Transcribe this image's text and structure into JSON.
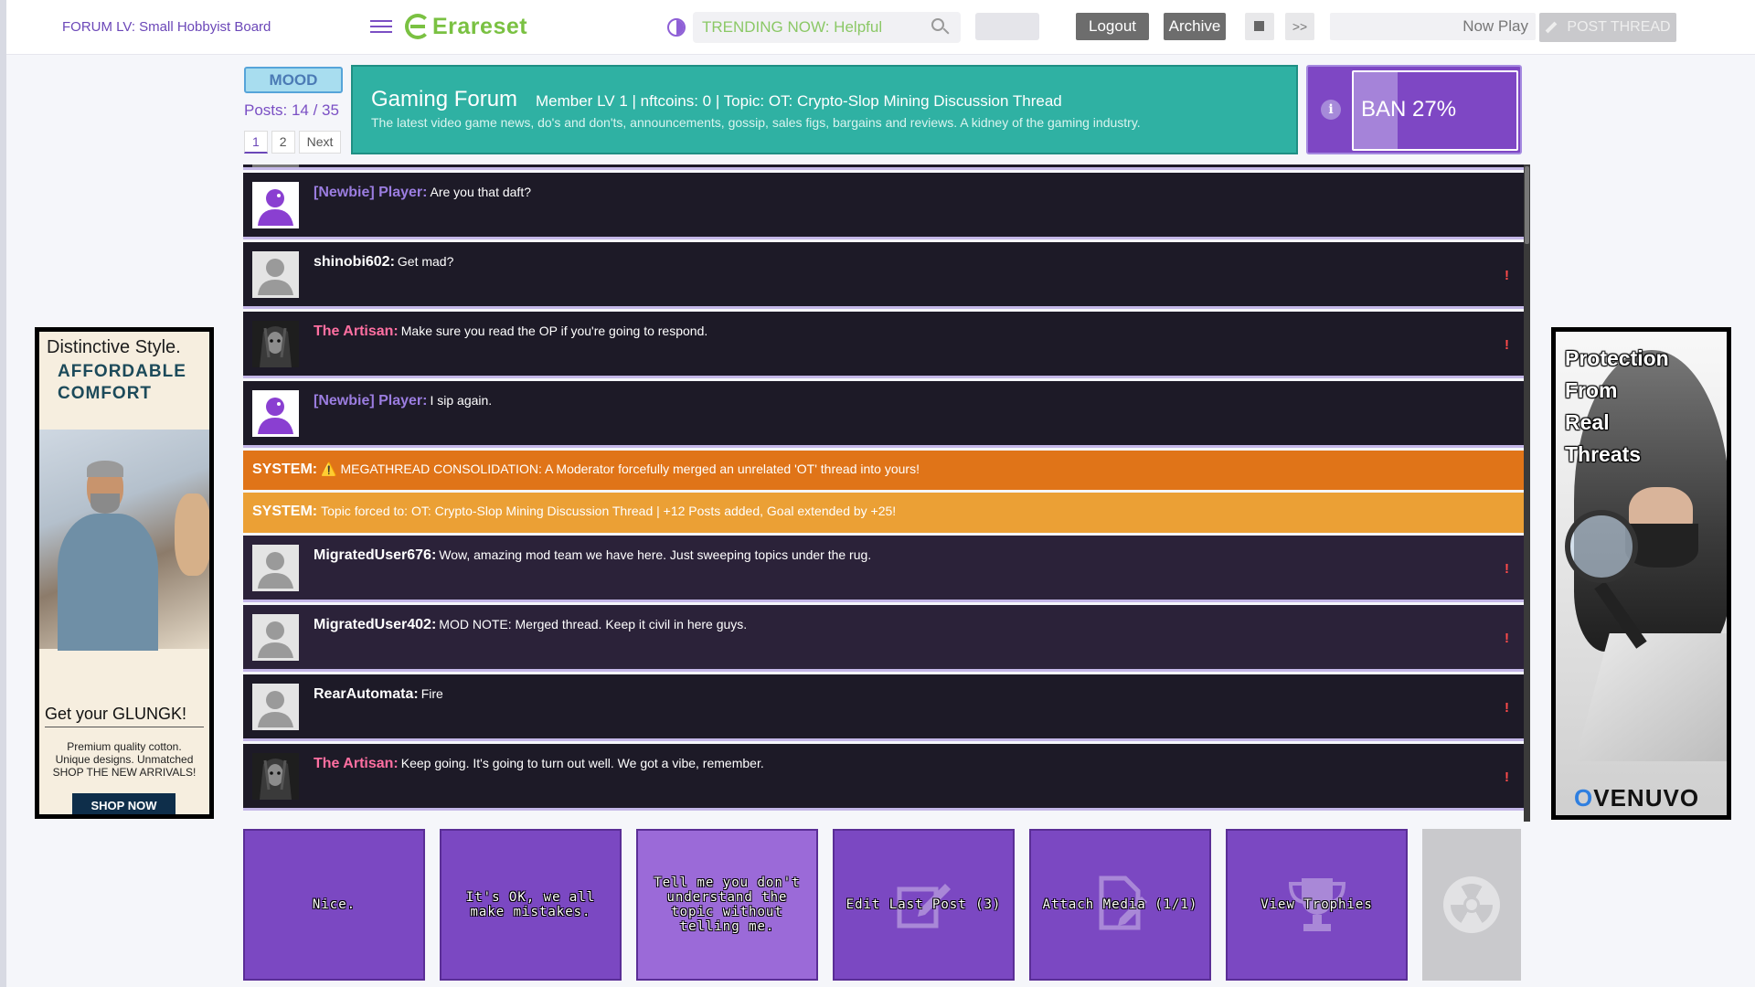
{
  "topbar": {
    "forum_level": "FORUM LV: Small Hobbyist Board",
    "logo": "Erareset",
    "search_value": "TRENDING NOW: Helpful",
    "logout": "Logout",
    "archive": "Archive",
    "fast_forward": ">>",
    "now_playing": "Now Play",
    "post_thread": "POST THREAD"
  },
  "header": {
    "mood": "MOOD",
    "posts": "Posts: 14 / 35",
    "pages": [
      "1",
      "2",
      "Next"
    ],
    "forum_name": "Gaming Forum",
    "status_line": "Member LV 1 | nftcoins: 0 | Topic: OT: Crypto-Slop Mining Discussion Thread",
    "tagline": "The latest video game news, do's and don'ts, announcements, gossip, sales figs, bargains and reviews. A kidney of the gaming industry.",
    "ban_label": "BAN 27%",
    "ban_fraction": 0.27
  },
  "posts": [
    {
      "user": "[Newbie] Player:",
      "text": "Are you that daft?"
    },
    {
      "user": "shinobi602:",
      "text": "Get mad?",
      "flag": "!"
    },
    {
      "user": "The Artisan:",
      "text": "Make sure you read the OP if you're going to respond.",
      "flag": "!"
    },
    {
      "user": "[Newbie] Player:",
      "text": "I sip again."
    },
    {
      "label": "SYSTEM:",
      "text": "⚠️ MEGATHREAD CONSOLIDATION: A Moderator forcefully merged an unrelated 'OT' thread into yours!"
    },
    {
      "label": "SYSTEM:",
      "text": "Topic forced to: OT: Crypto-Slop Mining Discussion Thread | +12 Posts added, Goal extended by +25!"
    },
    {
      "user": "MigratedUser676:",
      "text": "Wow, amazing mod team we have here. Just sweeping topics under the rug.",
      "flag": "!"
    },
    {
      "user": "MigratedUser402:",
      "text": "MOD NOTE: Merged thread. Keep it civil in here guys.",
      "flag": "!"
    },
    {
      "user": "RearAutomata:",
      "text": "Fire",
      "flag": "!"
    },
    {
      "user": "The Artisan:",
      "text": "Keep going. It's going to turn out well. We got a vibe, remember.",
      "flag": "!"
    }
  ],
  "actions": [
    {
      "label": "Nice."
    },
    {
      "label": "It's OK, we all make mistakes."
    },
    {
      "label": "Tell me you don't understand the topic without telling me."
    },
    {
      "label": "Edit Last Post (3)",
      "icon": "edit-icon"
    },
    {
      "label": "Attach Media (1/1)",
      "icon": "attach-icon"
    },
    {
      "label": "View Trophies",
      "icon": "trophy-icon"
    },
    {
      "label": "",
      "icon": "radiation-icon"
    }
  ],
  "ad_left": {
    "line1": "Distinctive Style.",
    "line2": "AFFORDABLE",
    "line3": "COMFORT",
    "headline": "Get your GLUNGK!",
    "body1": "Premium quality cotton.",
    "body2": "Unique designs. Unmatched",
    "body3": "SHOP THE NEW ARRIVALS!",
    "cta": "SHOP NOW"
  },
  "ad_right": {
    "line1": "Protection",
    "line2": "From",
    "line3": "Real",
    "line4": "Threats",
    "brand_o": "O",
    "brand_rest": "VENUVO"
  },
  "colors": {
    "accent": "#7b48c2",
    "banner": "#2fb1a3",
    "system_dark": "#e07418",
    "system_light": "#eba035",
    "logo_green": "#7ac142"
  }
}
